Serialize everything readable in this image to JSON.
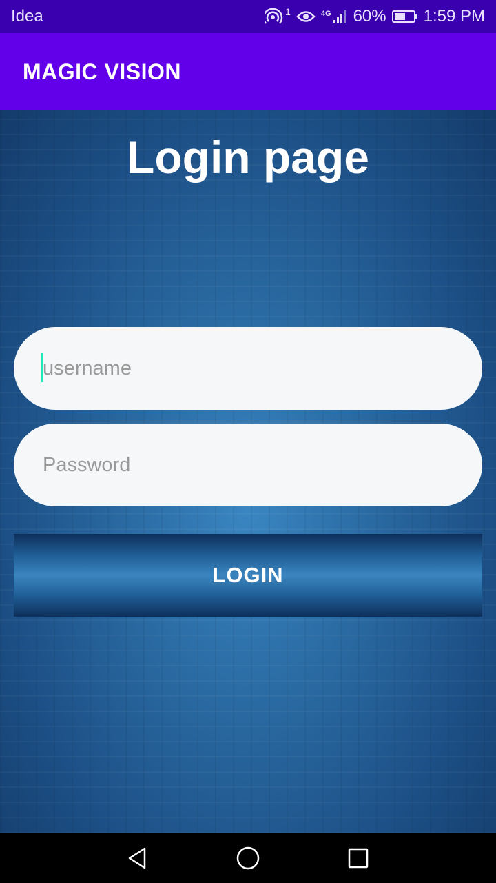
{
  "status_bar": {
    "carrier": "Idea",
    "signal_badge": "1",
    "network_type": "4G",
    "battery_percent": "60%",
    "battery_level": 0.6,
    "time": "1:59 PM",
    "icons": [
      "hotspot-icon",
      "eye-icon",
      "signal-icon",
      "battery-icon"
    ]
  },
  "app_bar": {
    "title": "MAGIC VISION",
    "color": "#6200ea"
  },
  "main": {
    "title": "Login page",
    "username": {
      "placeholder": "username",
      "value": ""
    },
    "password": {
      "placeholder": "Password",
      "value": ""
    },
    "login_label": "LOGIN"
  },
  "nav_bar": {
    "buttons": [
      "back-icon",
      "home-icon",
      "recent-apps-icon"
    ]
  }
}
